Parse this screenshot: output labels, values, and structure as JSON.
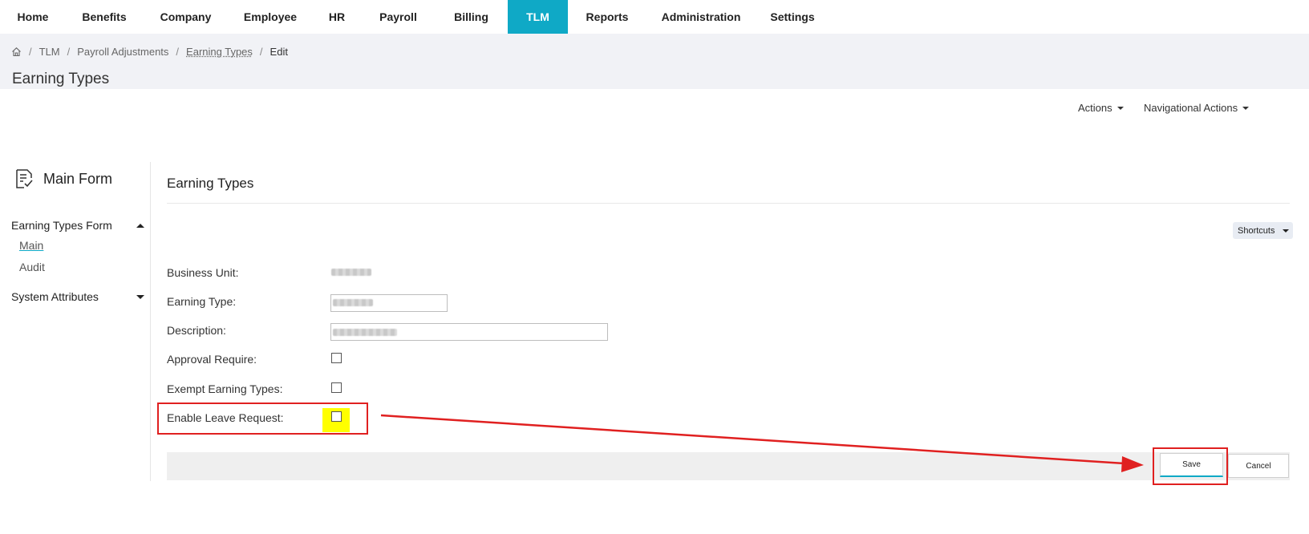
{
  "nav": {
    "items": [
      {
        "label": "Home"
      },
      {
        "label": "Benefits"
      },
      {
        "label": "Company"
      },
      {
        "label": "Employee"
      },
      {
        "label": "HR"
      },
      {
        "label": "Payroll"
      },
      {
        "label": "Billing"
      },
      {
        "label": "TLM",
        "active": true
      },
      {
        "label": "Reports"
      },
      {
        "label": "Administration"
      },
      {
        "label": "Settings"
      }
    ],
    "active_color": "#0fa9c6"
  },
  "breadcrumb": {
    "home_icon": "home-icon",
    "items": [
      "TLM",
      "Payroll Adjustments",
      "Earning Types",
      "Edit"
    ]
  },
  "page_title": "Earning Types",
  "actions": {
    "actions_label": "Actions",
    "nav_actions_label": "Navigational Actions"
  },
  "sidebar": {
    "title": "Main Form",
    "title_icon": "form-checklist-icon",
    "sections": [
      {
        "label": "Earning Types Form",
        "expanded": true,
        "links": [
          "Main",
          "Audit"
        ],
        "active_link": "Main"
      },
      {
        "label": "System Attributes",
        "expanded": false
      }
    ]
  },
  "form": {
    "title": "Earning Types",
    "shortcuts_label": "Shortcuts",
    "fields": {
      "business_unit": {
        "label": "Business Unit:"
      },
      "earning_type": {
        "label": "Earning Type:"
      },
      "description": {
        "label": "Description:"
      },
      "approval_require": {
        "label": "Approval Require:",
        "checked": false
      },
      "exempt_earning_types": {
        "label": "Exempt Earning Types:",
        "checked": false
      },
      "enable_leave_request": {
        "label": "Enable Leave Request:",
        "checked": false,
        "highlight_color": "#ffff00"
      }
    },
    "save_label": "Save",
    "cancel_label": "Cancel"
  },
  "annotation": {
    "color": "#e02020"
  }
}
